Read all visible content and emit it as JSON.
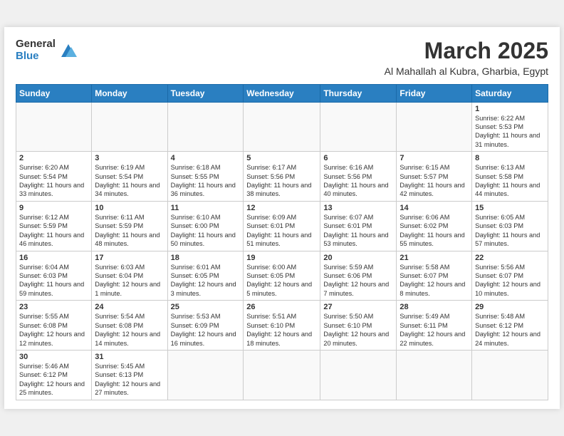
{
  "header": {
    "logo_general": "General",
    "logo_blue": "Blue",
    "month_title": "March 2025",
    "location": "Al Mahallah al Kubra, Gharbia, Egypt"
  },
  "weekdays": [
    "Sunday",
    "Monday",
    "Tuesday",
    "Wednesday",
    "Thursday",
    "Friday",
    "Saturday"
  ],
  "weeks": [
    [
      {
        "day": "",
        "info": ""
      },
      {
        "day": "",
        "info": ""
      },
      {
        "day": "",
        "info": ""
      },
      {
        "day": "",
        "info": ""
      },
      {
        "day": "",
        "info": ""
      },
      {
        "day": "",
        "info": ""
      },
      {
        "day": "1",
        "info": "Sunrise: 6:22 AM\nSunset: 5:53 PM\nDaylight: 11 hours and 31 minutes."
      }
    ],
    [
      {
        "day": "2",
        "info": "Sunrise: 6:20 AM\nSunset: 5:54 PM\nDaylight: 11 hours and 33 minutes."
      },
      {
        "day": "3",
        "info": "Sunrise: 6:19 AM\nSunset: 5:54 PM\nDaylight: 11 hours and 34 minutes."
      },
      {
        "day": "4",
        "info": "Sunrise: 6:18 AM\nSunset: 5:55 PM\nDaylight: 11 hours and 36 minutes."
      },
      {
        "day": "5",
        "info": "Sunrise: 6:17 AM\nSunset: 5:56 PM\nDaylight: 11 hours and 38 minutes."
      },
      {
        "day": "6",
        "info": "Sunrise: 6:16 AM\nSunset: 5:56 PM\nDaylight: 11 hours and 40 minutes."
      },
      {
        "day": "7",
        "info": "Sunrise: 6:15 AM\nSunset: 5:57 PM\nDaylight: 11 hours and 42 minutes."
      },
      {
        "day": "8",
        "info": "Sunrise: 6:13 AM\nSunset: 5:58 PM\nDaylight: 11 hours and 44 minutes."
      }
    ],
    [
      {
        "day": "9",
        "info": "Sunrise: 6:12 AM\nSunset: 5:59 PM\nDaylight: 11 hours and 46 minutes."
      },
      {
        "day": "10",
        "info": "Sunrise: 6:11 AM\nSunset: 5:59 PM\nDaylight: 11 hours and 48 minutes."
      },
      {
        "day": "11",
        "info": "Sunrise: 6:10 AM\nSunset: 6:00 PM\nDaylight: 11 hours and 50 minutes."
      },
      {
        "day": "12",
        "info": "Sunrise: 6:09 AM\nSunset: 6:01 PM\nDaylight: 11 hours and 51 minutes."
      },
      {
        "day": "13",
        "info": "Sunrise: 6:07 AM\nSunset: 6:01 PM\nDaylight: 11 hours and 53 minutes."
      },
      {
        "day": "14",
        "info": "Sunrise: 6:06 AM\nSunset: 6:02 PM\nDaylight: 11 hours and 55 minutes."
      },
      {
        "day": "15",
        "info": "Sunrise: 6:05 AM\nSunset: 6:03 PM\nDaylight: 11 hours and 57 minutes."
      }
    ],
    [
      {
        "day": "16",
        "info": "Sunrise: 6:04 AM\nSunset: 6:03 PM\nDaylight: 11 hours and 59 minutes."
      },
      {
        "day": "17",
        "info": "Sunrise: 6:03 AM\nSunset: 6:04 PM\nDaylight: 12 hours and 1 minute."
      },
      {
        "day": "18",
        "info": "Sunrise: 6:01 AM\nSunset: 6:05 PM\nDaylight: 12 hours and 3 minutes."
      },
      {
        "day": "19",
        "info": "Sunrise: 6:00 AM\nSunset: 6:05 PM\nDaylight: 12 hours and 5 minutes."
      },
      {
        "day": "20",
        "info": "Sunrise: 5:59 AM\nSunset: 6:06 PM\nDaylight: 12 hours and 7 minutes."
      },
      {
        "day": "21",
        "info": "Sunrise: 5:58 AM\nSunset: 6:07 PM\nDaylight: 12 hours and 8 minutes."
      },
      {
        "day": "22",
        "info": "Sunrise: 5:56 AM\nSunset: 6:07 PM\nDaylight: 12 hours and 10 minutes."
      }
    ],
    [
      {
        "day": "23",
        "info": "Sunrise: 5:55 AM\nSunset: 6:08 PM\nDaylight: 12 hours and 12 minutes."
      },
      {
        "day": "24",
        "info": "Sunrise: 5:54 AM\nSunset: 6:08 PM\nDaylight: 12 hours and 14 minutes."
      },
      {
        "day": "25",
        "info": "Sunrise: 5:53 AM\nSunset: 6:09 PM\nDaylight: 12 hours and 16 minutes."
      },
      {
        "day": "26",
        "info": "Sunrise: 5:51 AM\nSunset: 6:10 PM\nDaylight: 12 hours and 18 minutes."
      },
      {
        "day": "27",
        "info": "Sunrise: 5:50 AM\nSunset: 6:10 PM\nDaylight: 12 hours and 20 minutes."
      },
      {
        "day": "28",
        "info": "Sunrise: 5:49 AM\nSunset: 6:11 PM\nDaylight: 12 hours and 22 minutes."
      },
      {
        "day": "29",
        "info": "Sunrise: 5:48 AM\nSunset: 6:12 PM\nDaylight: 12 hours and 24 minutes."
      }
    ],
    [
      {
        "day": "30",
        "info": "Sunrise: 5:46 AM\nSunset: 6:12 PM\nDaylight: 12 hours and 25 minutes."
      },
      {
        "day": "31",
        "info": "Sunrise: 5:45 AM\nSunset: 6:13 PM\nDaylight: 12 hours and 27 minutes."
      },
      {
        "day": "",
        "info": ""
      },
      {
        "day": "",
        "info": ""
      },
      {
        "day": "",
        "info": ""
      },
      {
        "day": "",
        "info": ""
      },
      {
        "day": "",
        "info": ""
      }
    ]
  ]
}
